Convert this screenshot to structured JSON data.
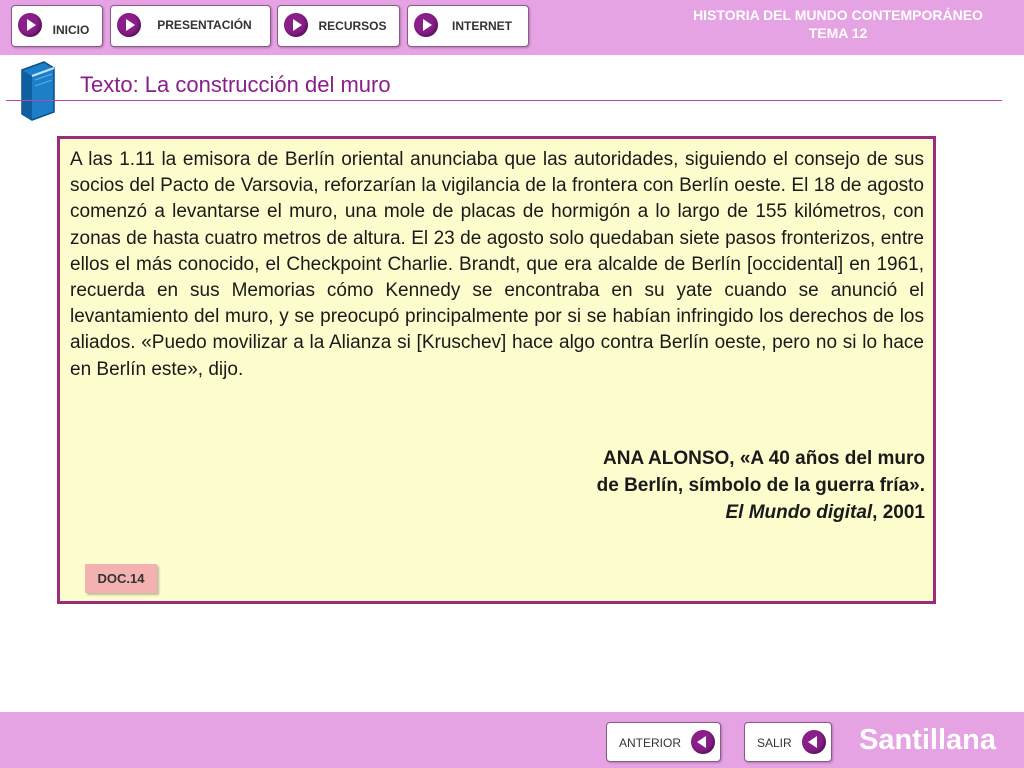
{
  "colors": {
    "bar": "#e6a3e3",
    "accent": "#8a1e8a",
    "doc_background": "#fcfccd",
    "doc_border": "#9c2b7a",
    "tag_background": "#f3b1b1"
  },
  "nav": {
    "inicio": "INICIO",
    "presentacion": "PRESENTACIÓN",
    "recursos": "RECURSOS",
    "internet": "INTERNET",
    "icon": "play-arrow-icon"
  },
  "header": {
    "line1": "HISTORIA DEL MUNDO CONTEMPORÁNEO",
    "line2": "TEMA 12"
  },
  "section": {
    "icon": "book-icon",
    "title": "Texto: La construcción del muro"
  },
  "document": {
    "text": "A las 1.11 la emisora de Berlín oriental anunciaba que las autoridades, siguiendo el consejo de sus socios del Pacto de Varsovia, reforzarían la vigilancia de la frontera con Berlín oeste. El 18 de agosto comenzó a levantarse el muro, una mole de placas de hormigón a lo largo de 155 kilómetros, con zonas de hasta cuatro metros de altura. El 23 de agosto solo quedaban siete pasos fronterizos, entre ellos el más conocido, el Checkpoint Charlie. Brandt, que era alcalde de Berlín [occidental] en 1961, recuerda en sus Memorias cómo Kennedy se encontraba en su yate cuando se anunció el levantamiento del muro, y se preocupó principalmente por si se habían infringido los derechos de los aliados. «Puedo movilizar a la Alianza si [Kruschev] hace algo contra Berlín oeste, pero no si lo hace en Berlín este», dijo.",
    "citation_line1": "ANA ALONSO, «A 40 años del muro",
    "citation_line2": "de Berlín, símbolo de la guerra fría».",
    "citation_source": "El Mundo digital",
    "citation_year": ", 2001",
    "tag": "DOC.14"
  },
  "footer": {
    "anterior": "ANTERIOR",
    "salir": "SALIR",
    "icon": "back-arrow-icon",
    "brand": "Santillana"
  }
}
